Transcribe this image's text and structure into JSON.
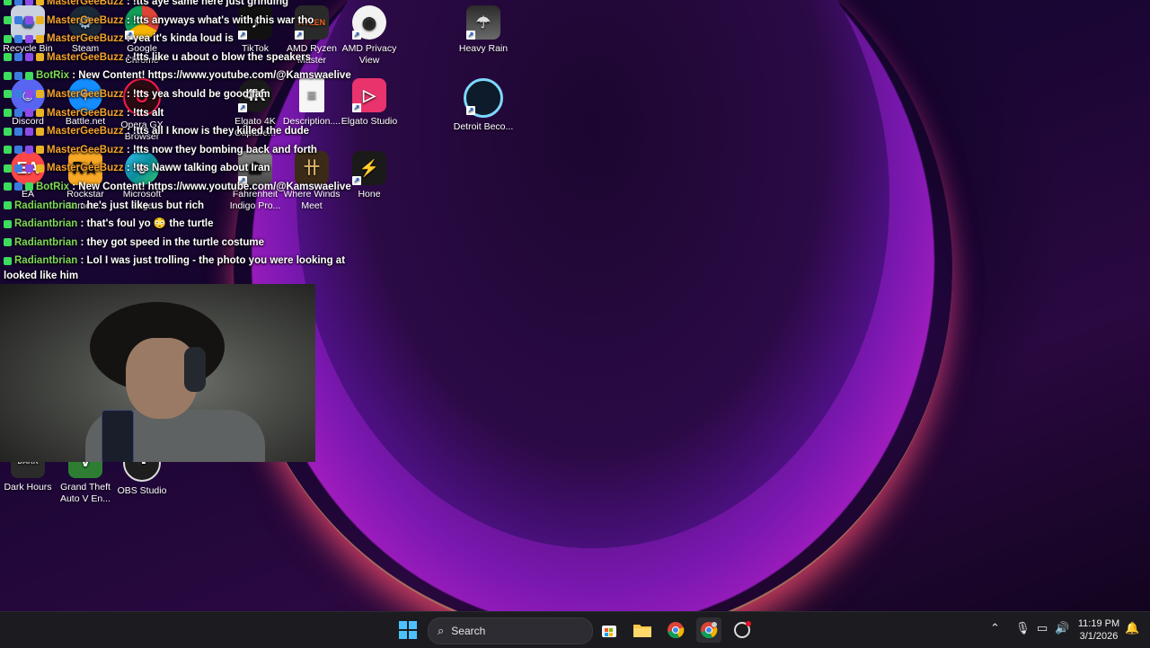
{
  "desktop": {
    "icons": [
      {
        "name": "recycle-bin-icon",
        "label": "Recycle Bin",
        "color": "#d7dde6"
      },
      {
        "name": "steam-icon",
        "label": "Steam",
        "color": "#1b2838"
      },
      {
        "name": "google-chrome-icon",
        "label": "Google Chrome",
        "color": "#db4437"
      },
      {
        "name": "tiktok-icon",
        "label": "TikTok",
        "color": "#111"
      },
      {
        "name": "amd-ryzen-master-icon",
        "label": "AMD Ryzen Master",
        "color": "#2a2a2a"
      },
      {
        "name": "amd-privacy-view-icon",
        "label": "AMD Privacy View",
        "color": "#333"
      },
      {
        "name": "heavy-rain-icon",
        "label": "Heavy Rain",
        "color": "#4a4a4a"
      },
      {
        "name": "discord-icon",
        "label": "Discord",
        "color": "#5865f2"
      },
      {
        "name": "battle-net-icon",
        "label": "Battle.net",
        "color": "#148eff"
      },
      {
        "name": "opera-gx-icon",
        "label": "Opera GX Browser",
        "color": "#2a0b12"
      },
      {
        "name": "elgato-4k-capture-icon",
        "label": "Elgato 4K Capture...",
        "color": "#222"
      },
      {
        "name": "description-file-icon",
        "label": "Description....",
        "color": "#f2f2f2"
      },
      {
        "name": "elgato-studio-icon",
        "label": "Elgato Studio",
        "color": "#e8336d"
      },
      {
        "name": "detroit-become-human-icon",
        "label": "Detroit Beco...",
        "color": "#0d1b2a"
      },
      {
        "name": "ea-icon",
        "label": "EA",
        "color": "#ff4747"
      },
      {
        "name": "rockstar-games-icon",
        "label": "Rockstar Games ...",
        "color": "#f9a825"
      },
      {
        "name": "microsoft-edge-icon",
        "label": "Microsoft Edge",
        "color": "#0c8c9c"
      },
      {
        "name": "fahrenheit-indigo-prophecy-icon",
        "label": "Fahrenheit Indigo Pro...",
        "color": "#6b6b6b"
      },
      {
        "name": "where-winds-meet-icon",
        "label": "Where Winds Meet",
        "color": "#3b2a18"
      },
      {
        "name": "hone-icon",
        "label": "Hone",
        "color": "#1a1a1a"
      },
      {
        "name": "dark-hours-icon",
        "label": "Dark Hours",
        "color": "#333"
      },
      {
        "name": "gta-v-enhanced-icon",
        "label": "Grand Theft Auto V En...",
        "color": "#2d7d32"
      },
      {
        "name": "obs-studio-icon",
        "label": "OBS Studio",
        "color": "#1e1e1e"
      }
    ]
  },
  "chat": {
    "messages": [
      {
        "user": "MasterGeeBuzz",
        "text": ": !tts aye same here just grinding",
        "kind": "mg"
      },
      {
        "user": "MasterGeeBuzz",
        "text": ": !tts anyways what's with this war tho",
        "kind": "mg"
      },
      {
        "user": "MasterGeeBuzz",
        "text": ": yea it's kinda loud is",
        "kind": "mg"
      },
      {
        "user": "MasterGeeBuzz",
        "text": ": !tts like u about o blow the speakers",
        "kind": "mg"
      },
      {
        "user": "BotRix",
        "text": ": New Content! https://www.youtube.com/@Kamswaelive",
        "kind": "bot"
      },
      {
        "user": "MasterGeeBuzz",
        "text": ": !tts yea should be good fam",
        "kind": "mg"
      },
      {
        "user": "MasterGeeBuzz",
        "text": ": !tts alt",
        "kind": "mg"
      },
      {
        "user": "MasterGeeBuzz",
        "text": ": !tts all I know is they killed the dude",
        "kind": "mg"
      },
      {
        "user": "MasterGeeBuzz",
        "text": ": !tts now they bombing back and forth",
        "kind": "mg"
      },
      {
        "user": "MasterGeeBuzz",
        "text": ": !tts Naww talking about Iran",
        "kind": "mg"
      },
      {
        "user": "BotRix",
        "text": ": New Content! https://www.youtube.com/@Kamswaelive",
        "kind": "bot"
      },
      {
        "user": "Radiantbrian",
        "text": ": he's just like us but rich",
        "kind": "rb"
      },
      {
        "user": "Radiantbrian",
        "text": ": that's foul yo 😳 the turtle",
        "kind": "rb"
      },
      {
        "user": "Radiantbrian",
        "text": ": they got speed in the turtle costume",
        "kind": "rb"
      },
      {
        "user": "Radiantbrian",
        "text": ": Lol I was just trolling - the photo you were looking at looked like him",
        "kind": "rb"
      }
    ]
  },
  "taskbar": {
    "search_placeholder": "Search",
    "clock_time": "11:19 PM",
    "clock_date": "3/1/2026",
    "pinned": [
      "windows-start-icon",
      "microsoft-store-icon",
      "file-explorer-icon",
      "chrome-icon",
      "chrome-profile-icon",
      "app-icon"
    ],
    "tray": [
      "chevron-up-icon",
      "microphone-icon",
      "network-icon",
      "speaker-icon",
      "notification-icon"
    ]
  },
  "colors": {
    "accent": "#3b7be0",
    "mg_user": "#f4a22c",
    "green_user": "#7ed957"
  }
}
